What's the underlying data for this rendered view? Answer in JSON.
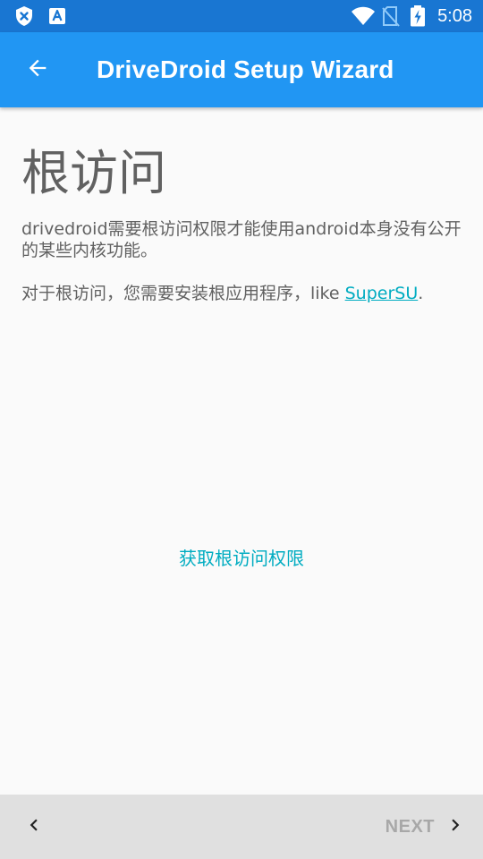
{
  "status_bar": {
    "time": "5:08",
    "icons": [
      "shield-x-icon",
      "font-a-icon",
      "wifi-icon",
      "no-sim-icon",
      "battery-charging-icon"
    ]
  },
  "app_bar": {
    "title": "DriveDroid Setup Wizard",
    "back_icon": "arrow-left-icon"
  },
  "content": {
    "heading": "根访问",
    "paragraph1": "drivedroid需要根访问权限才能使用android本身没有公开的某些内核功能。",
    "paragraph2_prefix": "对于根访问，您需要安装根应用程序，like ",
    "paragraph2_link": "SuperSU",
    "paragraph2_suffix": ".",
    "action_label": "获取根访问权限"
  },
  "bottom_bar": {
    "prev_icon": "chevron-left-icon",
    "next_label": "NEXT",
    "next_icon": "chevron-right-icon"
  },
  "colors": {
    "status_bar": "#1976d2",
    "app_bar": "#2196f3",
    "accent": "#00acc1",
    "text": "#616161",
    "bottom_bar": "#e0e0e0"
  }
}
